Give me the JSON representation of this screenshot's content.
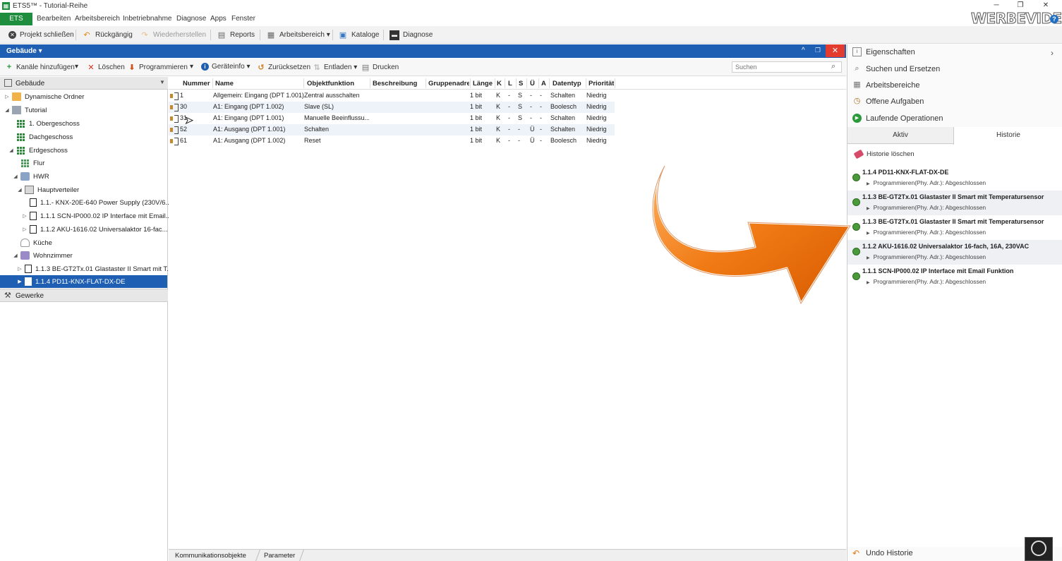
{
  "window": {
    "title": "ETS5™ - Tutorial-Reihe",
    "min_glyph": "─",
    "restore_glyph": "❐",
    "close_glyph": "✕"
  },
  "menu": {
    "ets_tab": "ETS",
    "items": [
      "Bearbeiten",
      "Arbeitsbereich",
      "Inbetriebnahme",
      "Diagnose",
      "Apps",
      "Fenster"
    ]
  },
  "brand": "WERBEVIDEO",
  "help_glyph": "?",
  "toolbar": {
    "projekt_schliessen": "Projekt schließen",
    "rueckgaengig": "Rückgängig",
    "wiederherstellen": "Wiederherstellen",
    "reports": "Reports",
    "arbeitsbereich": "Arbeitsbereich ▾",
    "kataloge": "Kataloge",
    "diagnose": "Diagnose"
  },
  "panel": {
    "title": "Gebäude ▾",
    "up_glyph": "^",
    "restore_glyph": "❐",
    "close_glyph": "✕"
  },
  "toolbar2": {
    "kanaele": "Kanäle hinzufügen",
    "dropdown": "▾",
    "loeschen": "Löschen",
    "programmieren": "Programmieren",
    "geraeteinfo": "Geräteinfo ▾",
    "zuruecksetzen": "Zurücksetzen",
    "entladen": "Entladen ▾",
    "drucken": "Drucken",
    "search_placeholder": "Suchen"
  },
  "tree": {
    "header": "Gebäude",
    "items": [
      {
        "label": "Dynamische Ordner",
        "expander": "▷"
      },
      {
        "label": "Tutorial",
        "expander": "◢"
      },
      {
        "label": "1. Obergeschoss",
        "expander": ""
      },
      {
        "label": "Dachgeschoss",
        "expander": ""
      },
      {
        "label": "Erdgeschoss",
        "expander": "◢"
      },
      {
        "label": "Flur",
        "expander": ""
      },
      {
        "label": "HWR",
        "expander": "◢"
      },
      {
        "label": "Hauptverteiler",
        "expander": "◢"
      },
      {
        "label": "1.1.- KNX-20E-640 Power Supply (230V/6...",
        "expander": ""
      },
      {
        "label": "1.1.1 SCN-IP000.02 IP Interface mit Email...",
        "expander": "▷"
      },
      {
        "label": "1.1.2 AKU-1616.02 Universalaktor 16-fac...",
        "expander": "▷"
      },
      {
        "label": "Küche",
        "expander": ""
      },
      {
        "label": "Wohnzimmer",
        "expander": "◢"
      },
      {
        "label": "1.1.3 BE-GT2Tx.01 Glastaster II Smart mit T...",
        "expander": "▷"
      },
      {
        "label": "1.1.4 PD11-KNX-FLAT-DX-DE",
        "expander": "▶"
      }
    ],
    "gewerke": "Gewerke"
  },
  "table": {
    "columns": [
      "Nummer",
      "Name",
      "Objektfunktion",
      "Beschreibung",
      "Gruppenadresse",
      "Länge",
      "K",
      "L",
      "S",
      "Ü",
      "A",
      "Datentyp",
      "Priorität"
    ],
    "rows": [
      [
        "1",
        "Allgemein: Eingang (DPT 1.001)",
        "Zentral ausschalten",
        "",
        "",
        "1 bit",
        "K",
        "-",
        "S",
        "-",
        "-",
        "Schalten",
        "Niedrig"
      ],
      [
        "30",
        "A1: Eingang (DPT 1.002)",
        "Slave (SL)",
        "",
        "",
        "1 bit",
        "K",
        "-",
        "S",
        "-",
        "-",
        "Boolesch",
        "Niedrig"
      ],
      [
        "31",
        "A1: Eingang (DPT 1.001)",
        "Manuelle Beeinflussu...",
        "",
        "",
        "1 bit",
        "K",
        "-",
        "S",
        "-",
        "-",
        "Schalten",
        "Niedrig"
      ],
      [
        "52",
        "A1: Ausgang (DPT 1.001)",
        "Schalten",
        "",
        "",
        "1 bit",
        "K",
        "-",
        "-",
        "Ü",
        "-",
        "Schalten",
        "Niedrig"
      ],
      [
        "61",
        "A1: Ausgang (DPT 1.002)",
        "Reset",
        "",
        "",
        "1 bit",
        "K",
        "-",
        "-",
        "Ü",
        "-",
        "Boolesch",
        "Niedrig"
      ]
    ]
  },
  "bottom_tabs": [
    "Kommunikationsobjekte",
    "Parameter"
  ],
  "right_panel": {
    "items": [
      "Eigenschaften",
      "Suchen und Ersetzen",
      "Arbeitsbereiche",
      "Offene Aufgaben",
      "Laufende Operationen"
    ],
    "chevron": "›",
    "tabs": {
      "aktiv": "Aktiv",
      "historie": "Historie"
    },
    "clear_history": "Historie löschen",
    "history": [
      {
        "title": "1.1.4 PD11-KNX-FLAT-DX-DE",
        "sub": "Programmieren(Phy. Adr.): Abgeschlossen"
      },
      {
        "title": "1.1.3 BE-GT2Tx.01 Glastaster II Smart mit Temperatursensor",
        "sub": "Programmieren(Phy. Adr.): Abgeschlossen"
      },
      {
        "title": "1.1.3 BE-GT2Tx.01 Glastaster II Smart mit Temperatursensor",
        "sub": "Programmieren(Phy. Adr.): Abgeschlossen"
      },
      {
        "title": "1.1.2 AKU-1616.02 Universalaktor 16-fach, 16A, 230VAC",
        "sub": "Programmieren(Phy. Adr.): Abgeschlossen"
      },
      {
        "title": "1.1.1 SCN-IP000.02 IP Interface mit Email Funktion",
        "sub": "Programmieren(Phy. Adr.): Abgeschlossen"
      }
    ],
    "undo_history": "Undo Historie"
  },
  "colors": {
    "accent_blue": "#1f5fb3",
    "ets_green": "#1e8e3e",
    "close_red": "#e33b2e",
    "arrow_orange": "#f07a14"
  }
}
